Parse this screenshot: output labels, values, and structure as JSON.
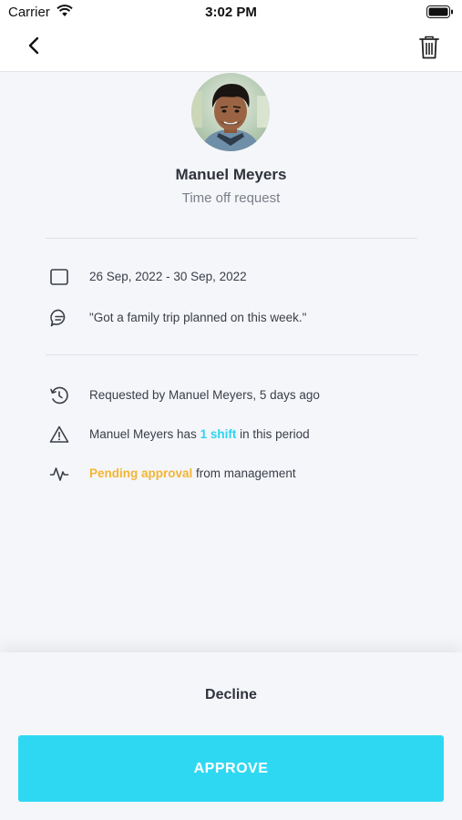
{
  "status_bar": {
    "carrier": "Carrier",
    "time": "3:02 PM"
  },
  "nav": {
    "back_icon": "chevron-left-icon",
    "trash_icon": "trash-icon"
  },
  "profile": {
    "name": "Manuel Meyers",
    "subtitle": "Time off request"
  },
  "details": {
    "date_range": "26 Sep, 2022 - 30 Sep, 2022",
    "comment": "\"Got a family trip planned on this week.\""
  },
  "info": {
    "requested": "Requested by Manuel Meyers, 5 days ago",
    "shift_prefix": "Manuel Meyers has ",
    "shift_highlight": "1 shift",
    "shift_suffix": " in this period",
    "pending_highlight": "Pending approval",
    "pending_suffix": " from management"
  },
  "actions": {
    "decline": "Decline",
    "approve": "APPROVE"
  },
  "colors": {
    "accent": "#2fd8f2",
    "highlight_blue": "#2dd4f0",
    "highlight_orange": "#f2b534"
  }
}
